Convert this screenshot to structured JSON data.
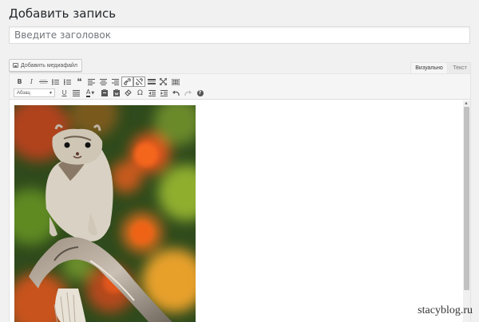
{
  "page": {
    "title": "Добавить запись"
  },
  "post_title": {
    "placeholder": "Введите заголовок"
  },
  "media_button": {
    "label": "Добавить медиафайл"
  },
  "tabs": {
    "visual": "Визуально",
    "text": "Текст"
  },
  "toolbar": {
    "bold": "B",
    "italic": "I",
    "strike": "ABC",
    "quote": "❝",
    "format": "Абзац",
    "underline": "U",
    "text_color": "A",
    "omega": "Ω",
    "help": "?"
  },
  "watermark": "stacyblog.ru"
}
